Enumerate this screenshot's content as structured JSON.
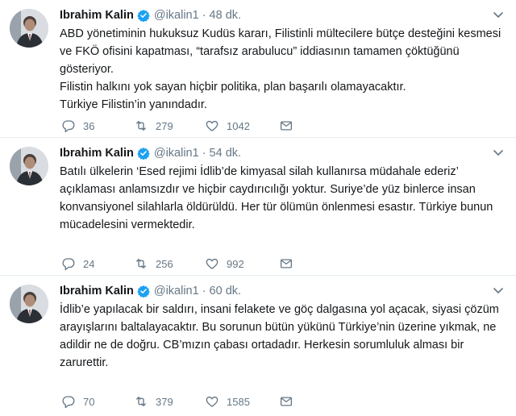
{
  "colors": {
    "verified": "#1da1f2",
    "muted": "#657786",
    "text": "#14171a",
    "divider": "#e6ecf0"
  },
  "icons": {
    "reply": "reply-icon",
    "retweet": "retweet-icon",
    "like": "heart-icon",
    "dm": "envelope-icon",
    "verified": "verified-badge-icon",
    "menu": "chevron-down-icon"
  },
  "tweets": [
    {
      "name": "Ibrahim Kalin",
      "handle": "@ikalin1",
      "separator": "·",
      "time": "48 dk.",
      "lines": [
        "ABD yönetiminin hukuksuz Kudüs kararı, Filistinli mültecilere bütçe desteğini kesmesi ve FKÖ ofisini kapatması, “tarafsız arabulucu” iddiasının tamamen çöktüğünü gösteriyor.",
        "Filistin halkını yok sayan hiçbir politika, plan başarılı olamayacaktır.",
        "Türkiye Filistin’in yanındadır."
      ],
      "replies": "36",
      "retweets": "279",
      "likes": "1042"
    },
    {
      "name": "Ibrahim Kalin",
      "handle": "@ikalin1",
      "separator": "·",
      "time": "54 dk.",
      "lines": [
        "Batılı ülkelerin ‘Esed rejimi İdlib’de kimyasal silah kullanırsa müdahale ederiz’ açıklaması anlamsızdır ve hiçbir caydırıcılığı yoktur. Suriye’de yüz binlerce insan konvansiyonel silahlarla öldürüldü. Her tür ölümün önlenmesi esastır. Türkiye bunun mücadelesini vermektedir."
      ],
      "replies": "24",
      "retweets": "256",
      "likes": "992"
    },
    {
      "name": "Ibrahim Kalin",
      "handle": "@ikalin1",
      "separator": "·",
      "time": "60 dk.",
      "lines": [
        "İdlib’e yapılacak bir saldırı, insani felakete ve göç dalgasına yol açacak, siyasi çözüm arayışlarını baltalayacaktır. Bu sorunun bütün yükünü Türkiye’nin üzerine yıkmak, ne adildir ne de doğru. CB’mızın çabası ortadadır. Herkesin sorumluluk alması bir zarurettir."
      ],
      "replies": "70",
      "retweets": "379",
      "likes": "1585"
    }
  ]
}
